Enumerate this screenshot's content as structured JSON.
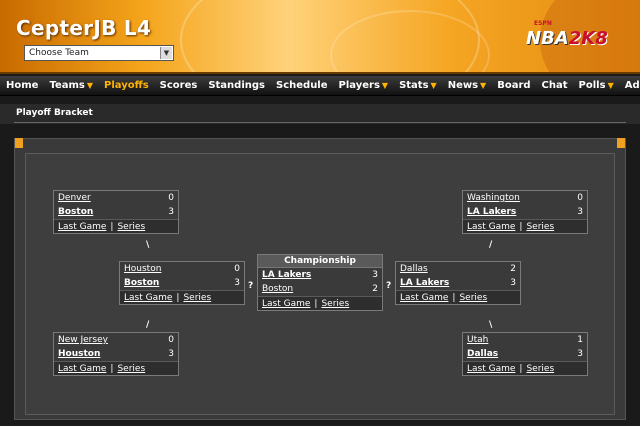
{
  "header": {
    "title": "CepterJB L4",
    "team_select": "Choose Team",
    "logo_espn": "ESPN",
    "logo_nba": "NBA",
    "logo_2k8": "2K8"
  },
  "nav": [
    "Home",
    "Teams",
    "Playoffs",
    "Scores",
    "Standings",
    "Schedule",
    "Players",
    "Stats",
    "News",
    "Board",
    "Chat",
    "Polls",
    "Admin"
  ],
  "nav_dropdowns": {
    "Teams": true,
    "Players": true,
    "Stats": true,
    "News": true,
    "Polls": true,
    "Admin": true
  },
  "nav_active": "Playoffs",
  "page": {
    "title": "Playoff Bracket"
  },
  "links": {
    "last_game": "Last Game",
    "separator": "|",
    "series": "Series"
  },
  "bracket": {
    "west_r1_top": {
      "teams": [
        {
          "name": "Denver",
          "wins": "0",
          "winner": false
        },
        {
          "name": "Boston",
          "wins": "3",
          "winner": true
        }
      ]
    },
    "west_r1_bottom": {
      "teams": [
        {
          "name": "New Jersey",
          "wins": "0",
          "winner": false
        },
        {
          "name": "Houston",
          "wins": "3",
          "winner": true
        }
      ]
    },
    "west_final": {
      "teams": [
        {
          "name": "Houston",
          "wins": "0",
          "winner": false
        },
        {
          "name": "Boston",
          "wins": "3",
          "winner": true
        }
      ]
    },
    "championship": {
      "label": "Championship",
      "teams": [
        {
          "name": "LA Lakers",
          "wins": "3",
          "winner": true
        },
        {
          "name": "Boston",
          "wins": "2",
          "winner": false
        }
      ]
    },
    "east_final": {
      "teams": [
        {
          "name": "Dallas",
          "wins": "2",
          "winner": false
        },
        {
          "name": "LA Lakers",
          "wins": "3",
          "winner": true
        }
      ]
    },
    "east_r1_top": {
      "teams": [
        {
          "name": "Washington",
          "wins": "0",
          "winner": false
        },
        {
          "name": "LA Lakers",
          "wins": "3",
          "winner": true
        }
      ]
    },
    "east_r1_bottom": {
      "teams": [
        {
          "name": "Utah",
          "wins": "1",
          "winner": false
        },
        {
          "name": "Dallas",
          "wins": "3",
          "winner": true
        }
      ]
    }
  },
  "connectors": {
    "backslash": "\\",
    "slash": "/",
    "unknown": "?"
  }
}
